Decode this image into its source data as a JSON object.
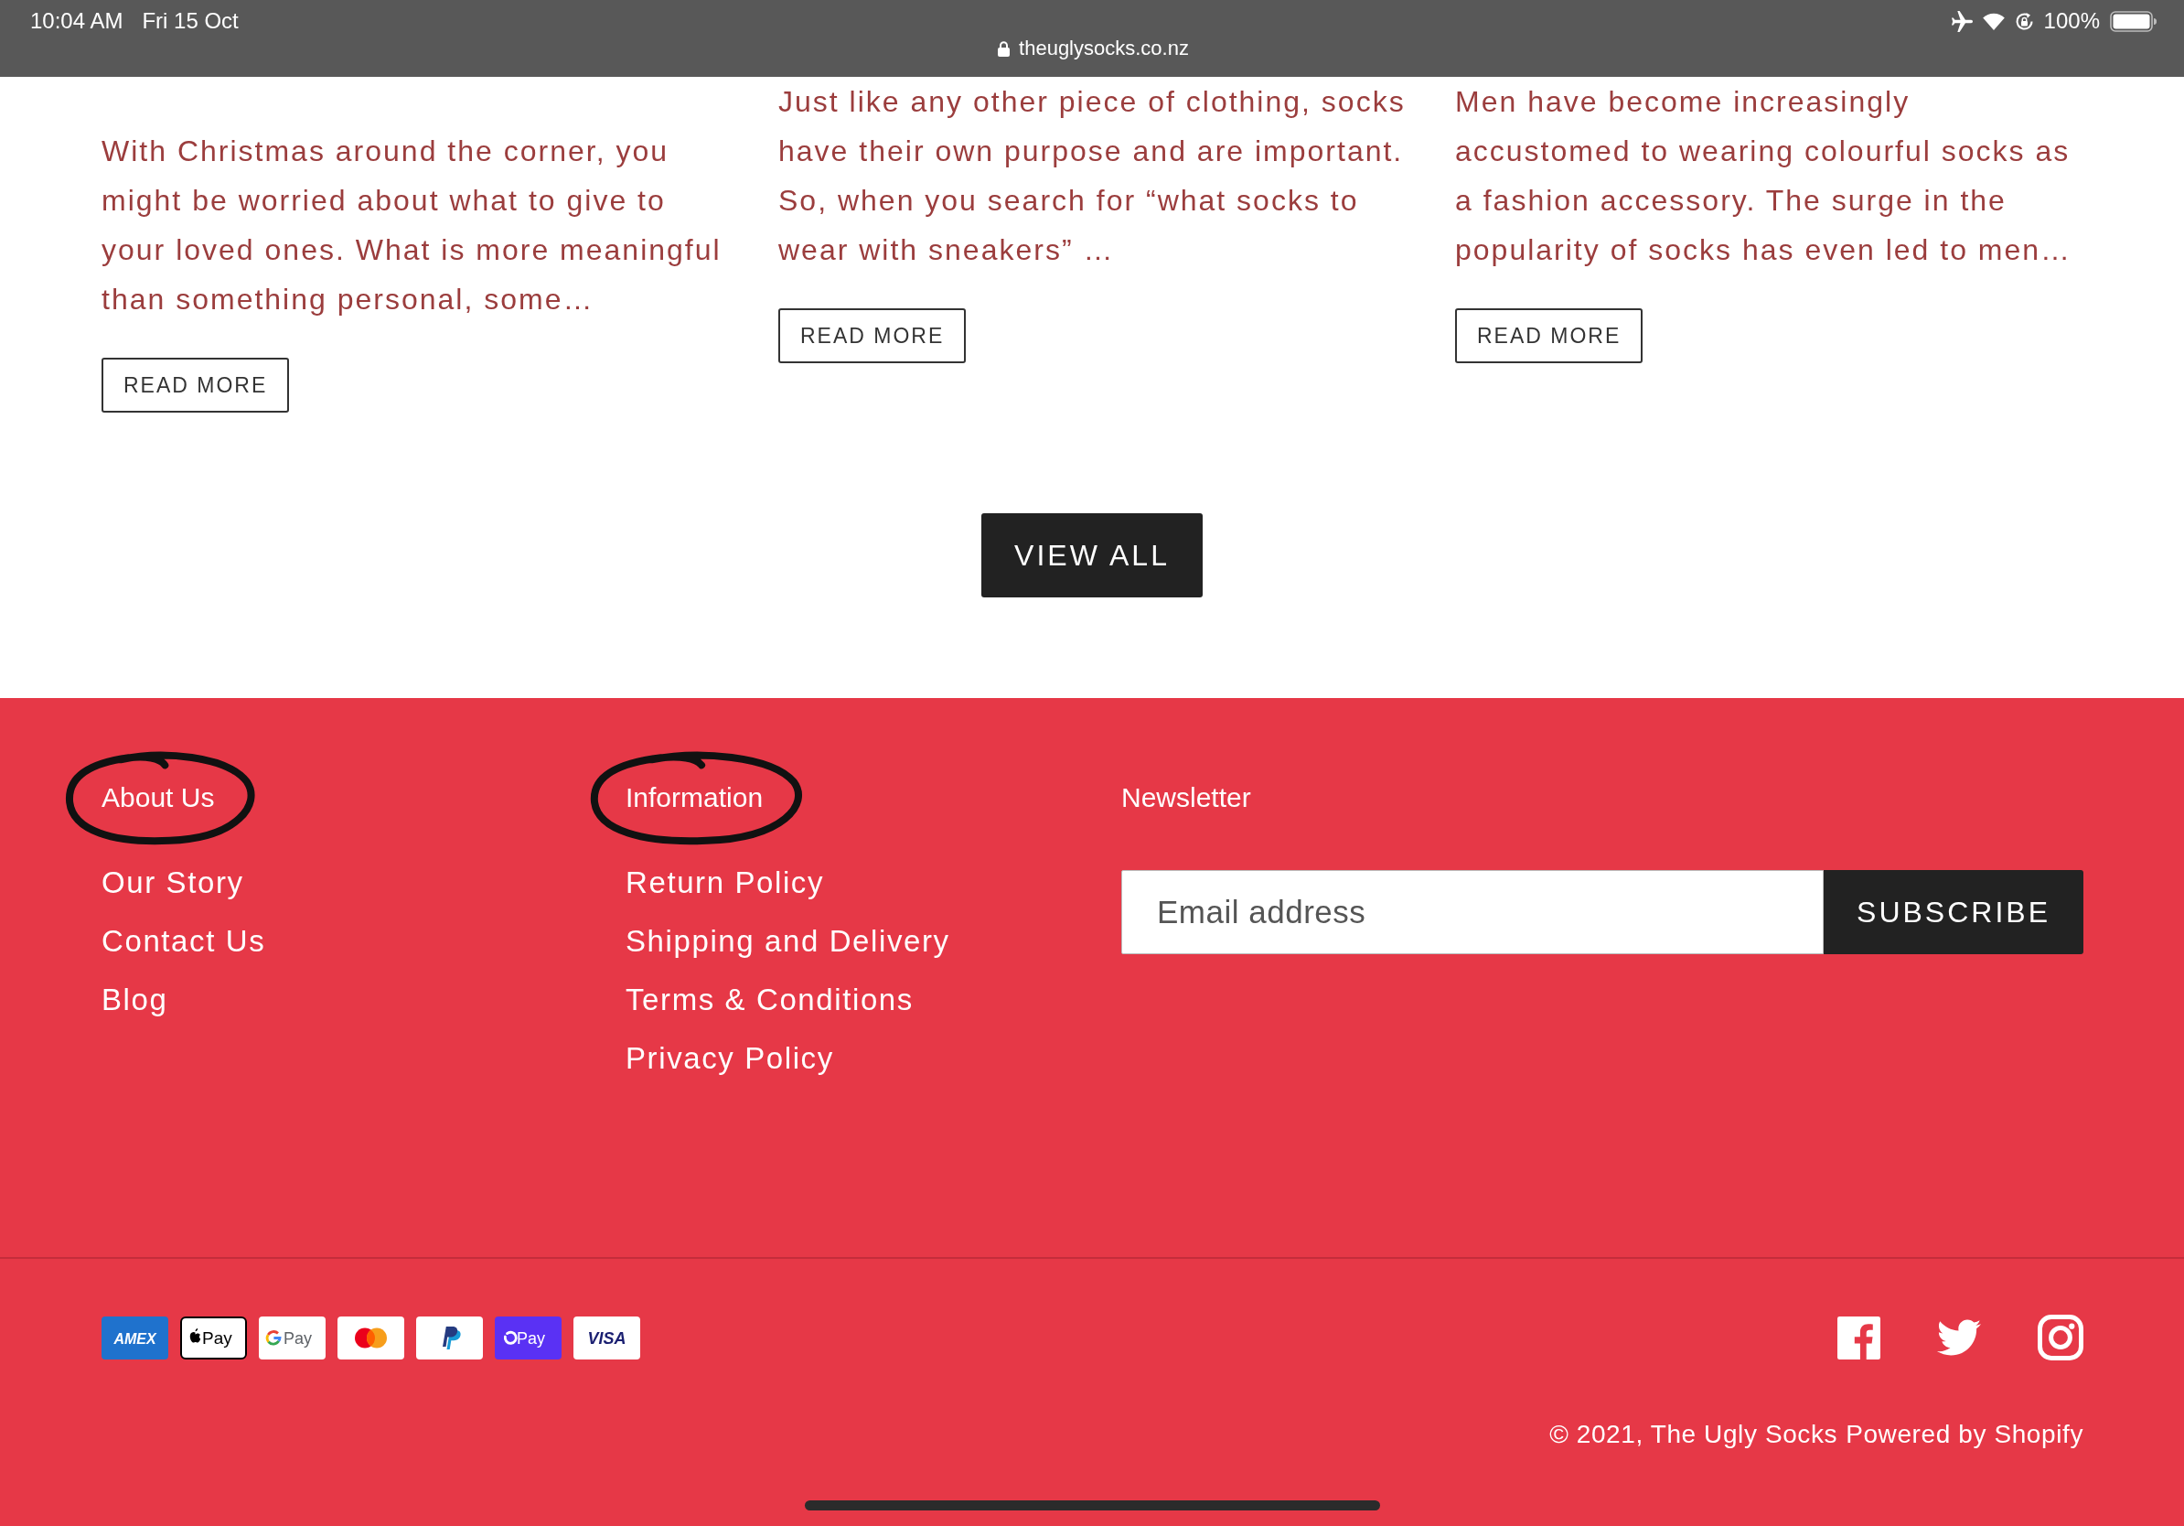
{
  "status_bar": {
    "time": "10:04 AM",
    "date": "Fri 15 Oct",
    "url": "theuglysocks.co.nz",
    "battery": "100%"
  },
  "blog_posts": [
    {
      "excerpt": "With Christmas around the corner, you might be worried about what to give to your loved ones. What is more meaningful than something personal, some…",
      "button": "READ MORE"
    },
    {
      "excerpt": "Just like any other piece of clothing, socks have their own purpose and are important. So, when you search for “what socks to wear with sneakers” …",
      "button": "READ MORE"
    },
    {
      "excerpt": "Men have become increasingly accustomed to wearing colourful socks as a fashion accessory. The surge in the popularity of socks has even led to men…",
      "button": "READ MORE"
    }
  ],
  "view_all": "VIEW ALL",
  "footer": {
    "columns": [
      {
        "kind": "links",
        "heading": "About Us",
        "circled": true,
        "links": [
          "Our Story",
          "Contact Us",
          "Blog"
        ]
      },
      {
        "kind": "links",
        "heading": "Information",
        "circled": true,
        "links": [
          "Return Policy",
          "Shipping and Delivery",
          "Terms & Conditions",
          "Privacy Policy"
        ]
      },
      {
        "kind": "newsletter",
        "heading": "Newsletter",
        "circled": false,
        "placeholder": "Email address",
        "button": "SUBSCRIBE"
      }
    ],
    "payment_methods": [
      {
        "kind": "amex",
        "label": "AMEX"
      },
      {
        "kind": "apple_pay",
        "label": "Pay"
      },
      {
        "kind": "google_pay",
        "label": "Pay"
      },
      {
        "kind": "mastercard"
      },
      {
        "kind": "paypal"
      },
      {
        "kind": "shop_pay",
        "label": "Pay"
      },
      {
        "kind": "visa",
        "label": "VISA"
      }
    ],
    "copyright": "© 2021, The Ugly Socks",
    "powered_by": "Powered by Shopify"
  }
}
